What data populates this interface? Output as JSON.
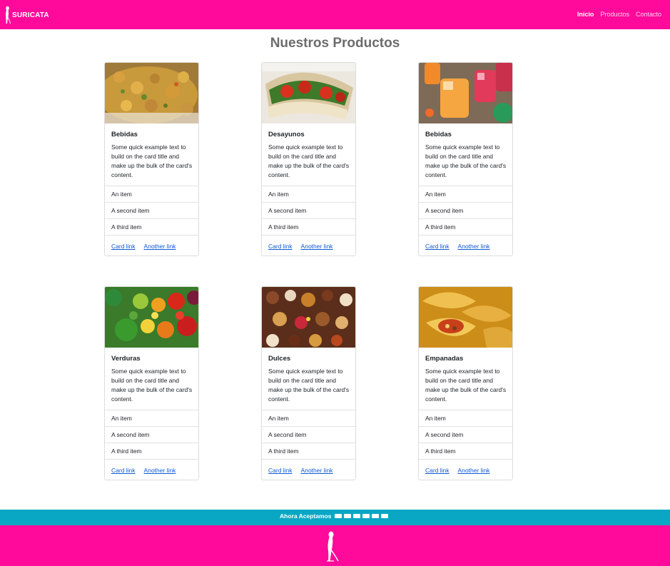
{
  "colors": {
    "brand_pink": "#ff0a9a",
    "accent_teal": "#0aa7c4",
    "link_blue": "#0d5ad6"
  },
  "navbar": {
    "brand_text": "SURICATA",
    "brand_icon": "meerkat-icon",
    "links": [
      {
        "label": "Inicio",
        "active": true
      },
      {
        "label": "Productos",
        "active": false
      },
      {
        "label": "Contacto",
        "active": false
      }
    ]
  },
  "main": {
    "title": "Nuestros Productos"
  },
  "cards": [
    {
      "title": "Bebidas",
      "image": "curry-food-image",
      "text": "Some quick example text to build on the card title and make up the bulk of the card's content.",
      "items": [
        "An item",
        "A second item",
        "A third item"
      ],
      "link1": "Card link",
      "link2": "Another link"
    },
    {
      "title": "Desayunos",
      "image": "sandwich-image",
      "text": "Some quick example text to build on the card title and make up the bulk of the card's content.",
      "items": [
        "An item",
        "A second item",
        "A third item"
      ],
      "link1": "Card link",
      "link2": "Another link"
    },
    {
      "title": "Bebidas",
      "image": "drinks-image",
      "text": "Some quick example text to build on the card title and make up the bulk of the card's content.",
      "items": [
        "An item",
        "A second item",
        "A third item"
      ],
      "link1": "Card link",
      "link2": "Another link"
    },
    {
      "title": "Verduras",
      "image": "vegetables-image",
      "text": "Some quick example text to build on the card title and make up the bulk of the card's content.",
      "items": [
        "An item",
        "A second item",
        "A third item"
      ],
      "link1": "Card link",
      "link2": "Another link"
    },
    {
      "title": "Dulces",
      "image": "sweets-image",
      "text": "Some quick example text to build on the card title and make up the bulk of the card's content.",
      "items": [
        "An item",
        "A second item",
        "A third item"
      ],
      "link1": "Card link",
      "link2": "Another link"
    },
    {
      "title": "Empanadas",
      "image": "empanadas-image",
      "text": "Some quick example text to build on the card title and make up the bulk of the card's content.",
      "items": [
        "An item",
        "A second item",
        "A third item"
      ],
      "link1": "Card link",
      "link2": "Another link"
    }
  ],
  "payment": {
    "text": "Ahora Aceptamos",
    "icons": [
      "visa-icon",
      "mastercard-icon",
      "diners-icon",
      "amex-icon",
      "bank-card-icon",
      "paypal-icon"
    ]
  },
  "footer": {
    "logo": "meerkat-icon"
  }
}
